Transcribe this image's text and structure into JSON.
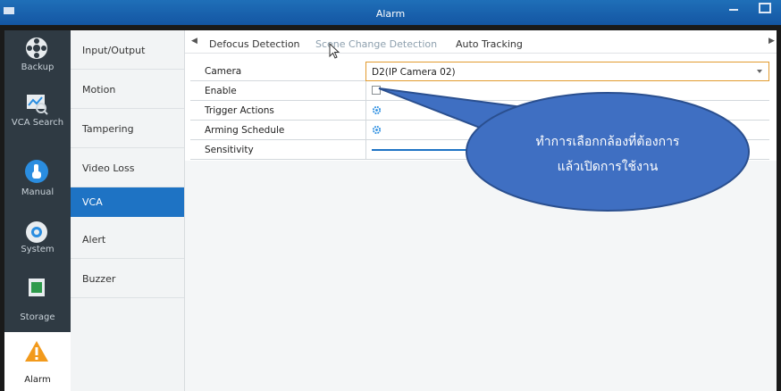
{
  "window": {
    "title": "Alarm"
  },
  "leftbar": {
    "items": [
      {
        "label": "Backup",
        "icon": "backup-icon"
      },
      {
        "label": "VCA Search",
        "icon": "vca-search-icon"
      },
      {
        "label": "Manual",
        "icon": "manual-icon"
      },
      {
        "label": "System",
        "icon": "system-icon"
      },
      {
        "label": "Storage",
        "icon": "storage-icon"
      },
      {
        "label": "Alarm",
        "icon": "alarm-icon"
      }
    ]
  },
  "submenu": {
    "items": [
      {
        "label": "Input/Output"
      },
      {
        "label": "Motion"
      },
      {
        "label": "Tampering"
      },
      {
        "label": "Video Loss"
      },
      {
        "label": "VCA"
      },
      {
        "label": "Alert"
      },
      {
        "label": "Buzzer"
      }
    ]
  },
  "tabs": {
    "items": [
      {
        "label": "Defocus Detection"
      },
      {
        "label": "Scene Change Detection"
      },
      {
        "label": "Auto Tracking"
      }
    ]
  },
  "form": {
    "camera": {
      "label": "Camera",
      "value": "D2(IP Camera 02)"
    },
    "enable": {
      "label": "Enable"
    },
    "trigger": {
      "label": "Trigger Actions"
    },
    "arming": {
      "label": "Arming Schedule"
    },
    "sensitivity": {
      "label": "Sensitivity"
    }
  },
  "callout": {
    "line1": "ทำการเลือกกล้องที่ต้องการ",
    "line2": "แล้วเปิดการใช้งาน"
  },
  "colors": {
    "titlebar": "#1a63ae",
    "active": "#1e73c4",
    "callout_fill": "#3f6fc2",
    "callout_stroke": "#2a4f8f"
  }
}
